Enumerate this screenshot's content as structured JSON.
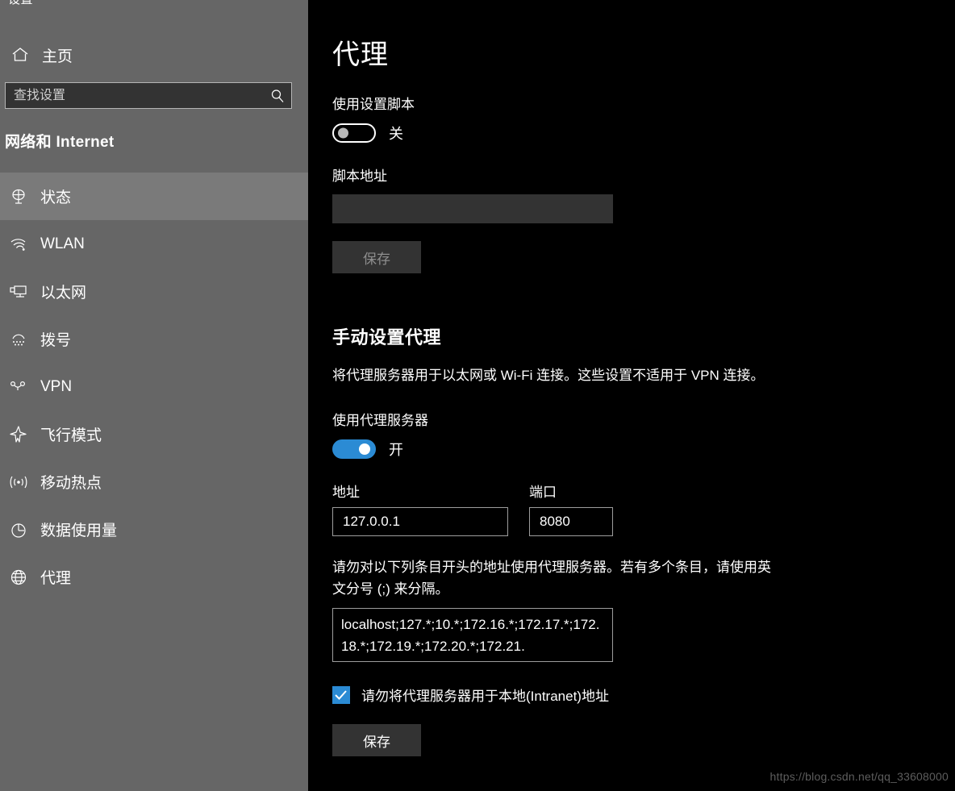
{
  "window": {
    "title": "设置"
  },
  "sidebar": {
    "home_label": "主页",
    "home_icon": "home-icon",
    "search": {
      "placeholder": "查找设置",
      "value": "",
      "icon": "search-icon"
    },
    "category_title": "网络和 Internet",
    "items": [
      {
        "label": "状态",
        "icon": "globe-status-icon",
        "selected": false,
        "highlight": true
      },
      {
        "label": "WLAN",
        "icon": "wifi-icon",
        "selected": false,
        "highlight": false
      },
      {
        "label": "以太网",
        "icon": "ethernet-icon",
        "selected": false,
        "highlight": false
      },
      {
        "label": "拨号",
        "icon": "dialup-icon",
        "selected": false,
        "highlight": false
      },
      {
        "label": "VPN",
        "icon": "vpn-icon",
        "selected": false,
        "highlight": false
      },
      {
        "label": "飞行模式",
        "icon": "airplane-icon",
        "selected": false,
        "highlight": false
      },
      {
        "label": "移动热点",
        "icon": "hotspot-icon",
        "selected": false,
        "highlight": false
      },
      {
        "label": "数据使用量",
        "icon": "data-usage-icon",
        "selected": false,
        "highlight": false
      },
      {
        "label": "代理",
        "icon": "proxy-globe-icon",
        "selected": true,
        "highlight": false
      }
    ]
  },
  "main": {
    "page_title": "代理",
    "auto_setup": {
      "toggle_label": "使用设置脚本",
      "toggle_state_text": "关",
      "toggle_on": false,
      "script_address_label": "脚本地址",
      "script_address_value": "",
      "save_label": "保存",
      "save_disabled": true
    },
    "manual_setup": {
      "heading": "手动设置代理",
      "description": "将代理服务器用于以太网或 Wi-Fi 连接。这些设置不适用于 VPN 连接。",
      "toggle_label": "使用代理服务器",
      "toggle_state_text": "开",
      "toggle_on": true,
      "address_label": "地址",
      "address_value": "127.0.0.1",
      "port_label": "端口",
      "port_value": "8080",
      "exception_description": "请勿对以下列条目开头的地址使用代理服务器。若有多个条目，请使用英文分号 (;) 来分隔。",
      "exception_value": "localhost;127.*;10.*;172.16.*;172.17.*;172.18.*;172.19.*;172.20.*;172.21.",
      "bypass_local_label": "请勿将代理服务器用于本地(Intranet)地址",
      "bypass_local_checked": true,
      "save_label": "保存"
    }
  },
  "watermark": {
    "text": "https://blog.csdn.net/qq_33608000"
  },
  "colors": {
    "accent": "#2b8bd4",
    "sidebar_bg": "#666666",
    "sidebar_highlight": "#7a7a7a",
    "main_bg": "#000000",
    "input_bg": "#333333"
  }
}
